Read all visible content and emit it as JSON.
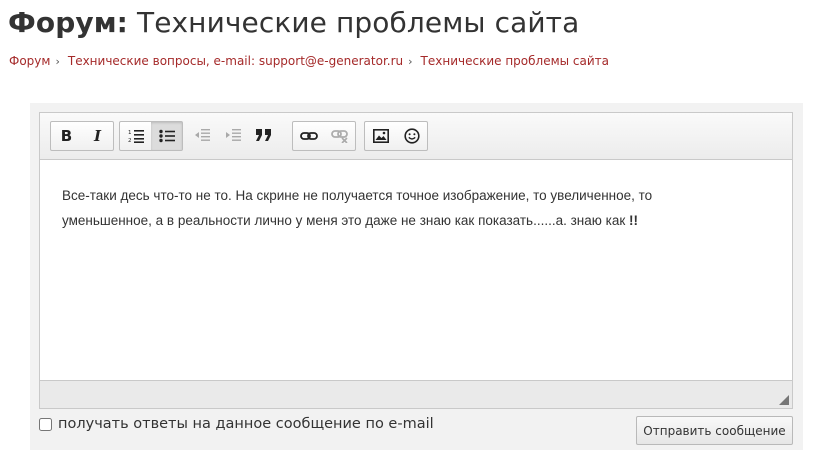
{
  "page": {
    "title_prefix": "Форум:",
    "title_rest": " Технические проблемы сайта"
  },
  "breadcrumb": {
    "items": [
      "Форум",
      "Технические вопросы, e-mail: support@e-generator.ru",
      "Технические проблемы сайта"
    ],
    "separator": "›"
  },
  "editor": {
    "toolbar": {
      "bold_label": "B",
      "italic_label": "I",
      "active_button": "bulleted-list",
      "disabled_buttons": [
        "outdent",
        "indent",
        "unlink"
      ]
    },
    "content_line1": "Все-таки десь что-то не то. На скрине не получается точное изображение, то увеличенное, то",
    "content_line2": "уменьшенное, а в реальности лично у меня это даже не знаю как показать......а. знаю как ",
    "content_emphasis": "!!"
  },
  "notify": {
    "label": "получать ответы на данное сообщение по e-mail",
    "checked": false
  },
  "submit": {
    "label": "Отправить сообщение"
  },
  "colors": {
    "link": "#a52a2a",
    "panel_bg": "#f2f2f2",
    "title": "#333333"
  }
}
